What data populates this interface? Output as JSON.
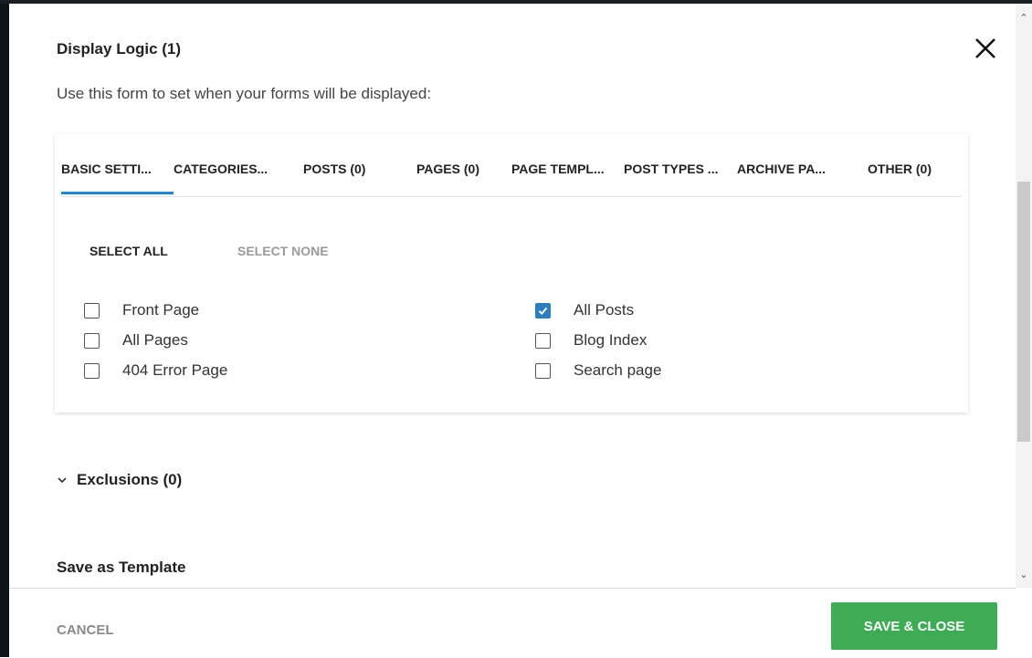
{
  "modal": {
    "title": "Display Logic (1)",
    "subtitle": "Use this form to set when your forms will be displayed:",
    "close_icon": "close-icon"
  },
  "tabs": [
    {
      "label": "BASIC SETTI...",
      "active": true
    },
    {
      "label": "CATEGORIES...",
      "active": false
    },
    {
      "label": "POSTS (0)",
      "active": false
    },
    {
      "label": "PAGES (0)",
      "active": false
    },
    {
      "label": "PAGE TEMPL...",
      "active": false
    },
    {
      "label": "POST TYPES ...",
      "active": false
    },
    {
      "label": "ARCHIVE PA...",
      "active": false
    },
    {
      "label": "OTHER (0)",
      "active": false
    }
  ],
  "selection": {
    "select_all": "SELECT ALL",
    "select_none": "SELECT NONE"
  },
  "checkboxes": {
    "left": [
      {
        "label": "Front Page",
        "checked": false
      },
      {
        "label": "All Pages",
        "checked": false
      },
      {
        "label": "404 Error Page",
        "checked": false
      }
    ],
    "right": [
      {
        "label": "All Posts",
        "checked": true
      },
      {
        "label": "Blog Index",
        "checked": false
      },
      {
        "label": "Search page",
        "checked": false
      }
    ]
  },
  "exclusions": {
    "label": "Exclusions (0)",
    "icon": "chevron-down-icon"
  },
  "save_template": {
    "label": "Save as Template"
  },
  "footer": {
    "cancel_label": "CANCEL",
    "save_label": "SAVE & CLOSE"
  },
  "colors": {
    "accent_blue": "#1e88d8",
    "checkbox_checked": "#2d7ebf",
    "save_green": "#3eab55",
    "muted_text": "#9a9a9a"
  }
}
